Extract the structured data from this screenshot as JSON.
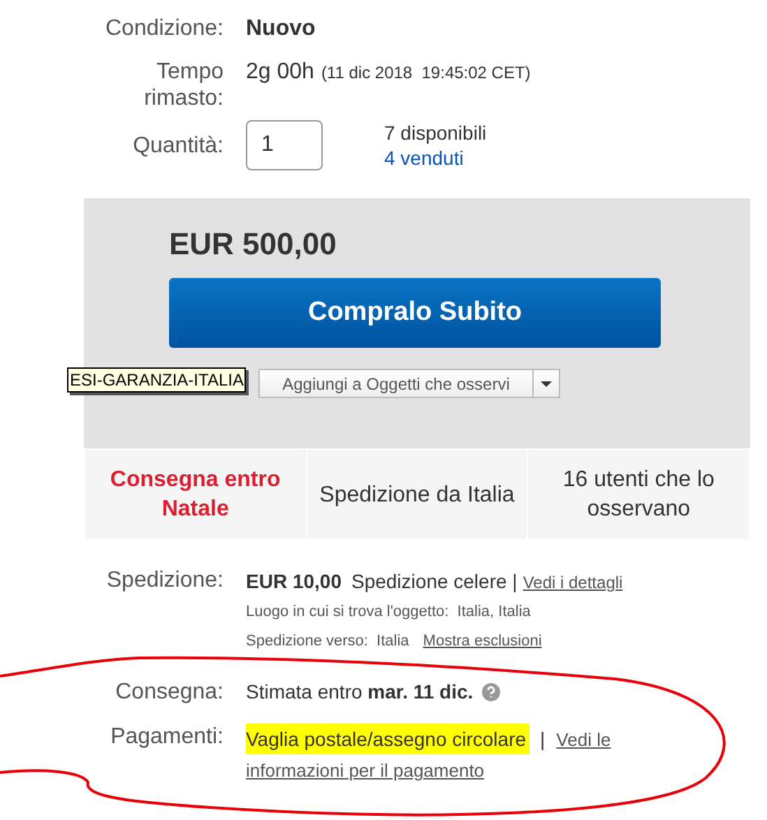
{
  "details_top": [
    {
      "label": "Condizione:",
      "value": "Nuovo",
      "kind": "bold"
    },
    {
      "label": "Tempo rimasto:",
      "value": "2g 00h",
      "note": "(11 dic 2018  19:45:02 CET)",
      "kind": "time"
    }
  ],
  "quantity": {
    "label": "Quantità:",
    "value": "1",
    "available": "7 disponibili",
    "sold": "4 venduti"
  },
  "buy_box": {
    "price": "EUR 500,00",
    "buy_button": "Compralo Subito",
    "watch_button": "Aggiungi a Oggetti che osservi",
    "tooltip": "ESI-GARANZIA-ITALIA",
    "badges": [
      {
        "text": "Consegna entro Natale",
        "highlight": true
      },
      {
        "text": "Spedizione da Italia",
        "highlight": false
      },
      {
        "text": "16 utenti che lo osservano",
        "highlight": false
      }
    ]
  },
  "shipping": {
    "label": "Spedizione:",
    "cost": "EUR 10,00",
    "service": "Spedizione celere |",
    "details_link": "Vedi i dettagli",
    "location": "Luogo in cui si trova l'oggetto:  Italia, Italia",
    "ships_to": "Spedizione verso:  Italia",
    "exclusions_link": "Mostra esclusioni"
  },
  "delivery": {
    "label": "Consegna:",
    "text": "Stimata entro **mar. 11 dic.**"
  },
  "payments": {
    "label": "Pagamenti:",
    "method": "Vaglia postale/assegno circolare",
    "highlighted": true,
    "separator": "|",
    "info_link_lines": [
      "Vedi le",
      "informazioni per il pagamento"
    ]
  }
}
